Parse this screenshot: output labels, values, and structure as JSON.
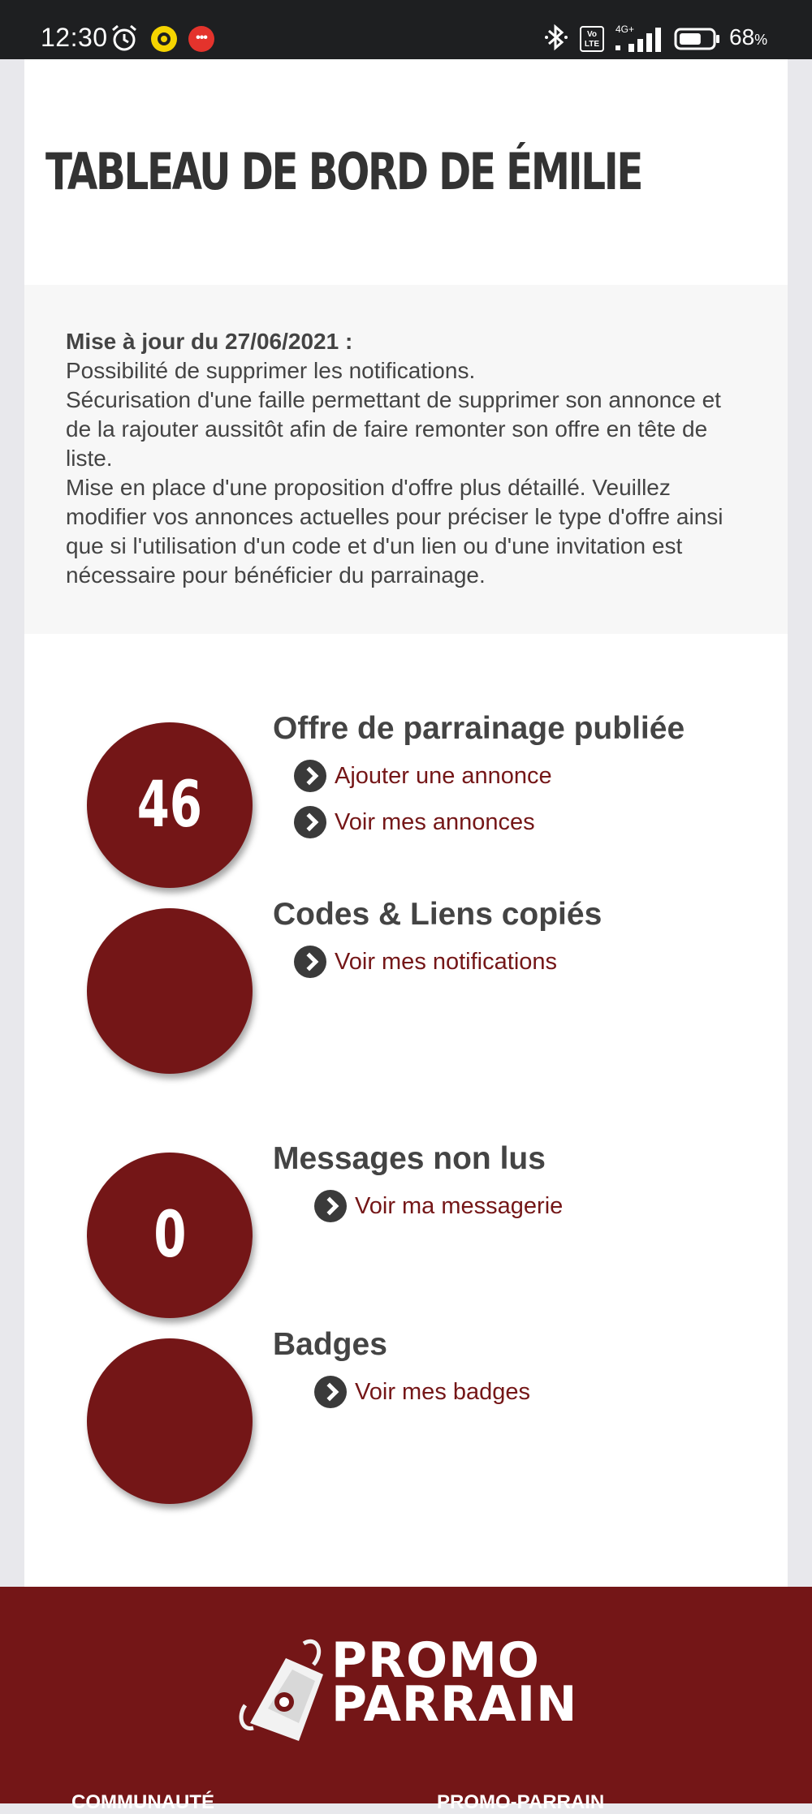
{
  "status_bar": {
    "time": "12:30",
    "volte": "Vo LTE",
    "network": "4G+",
    "battery_pct": "68",
    "battery_unit": "%",
    "battery_level": 0.68,
    "icons": [
      "alarm-icon",
      "yellow-ring-app-icon",
      "more-dots-icon",
      "bluetooth-icon",
      "volte-icon",
      "signal-icon",
      "battery-icon"
    ]
  },
  "header": {
    "title": "TABLEAU DE BORD DE ÉMILIE"
  },
  "update": {
    "title": "Mise à jour du 27/06/2021 :",
    "lines": [
      "Possibilité de supprimer les notifications.",
      "Sécurisation d'une faille permettant de supprimer son annonce et de la rajouter aussitôt afin de faire remonter son offre en tête de liste.",
      "Mise en place d'une proposition d'offre plus détaillé. Veuillez modifier vos annonces actuelles pour préciser le type d'offre ainsi que si l'utilisation d'un code et d'un lien ou d'une invitation est nécessaire pour bénéficier du parrainage."
    ]
  },
  "stats": [
    {
      "count": "46",
      "title": "Offre de parrainage publiée",
      "links": [
        "Ajouter une annonce",
        "Voir mes annonces"
      ]
    },
    {
      "count": "",
      "title": "Codes & Liens copiés",
      "links": [
        "Voir mes notifications"
      ]
    },
    {
      "count": "0",
      "title": "Messages non lus",
      "links": [
        "Voir ma messagerie"
      ]
    },
    {
      "count": "",
      "title": "Badges",
      "links": [
        "Voir mes badges"
      ]
    }
  ],
  "footer": {
    "logo_line1": "PROMO",
    "logo_line2": "PARRAIN",
    "col1": "COMMUNAUTÉ",
    "col2": "PROMO-PARRAIN"
  },
  "colors": {
    "brand": "#741617",
    "status_bar": "#1e1f21",
    "text": "#444444"
  }
}
